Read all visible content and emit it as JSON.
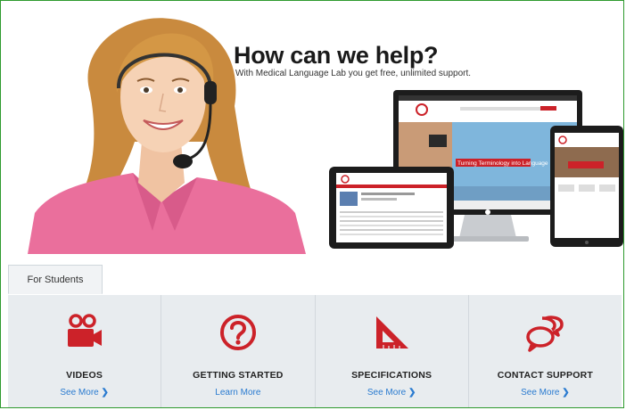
{
  "hero": {
    "title": "How can we help?",
    "subtitle": "With Medical Language Lab you get free, unlimited support.",
    "monitor_banner": "Turning Terminology into Language"
  },
  "tabs": [
    {
      "label": "For Students"
    }
  ],
  "features": [
    {
      "title": "VIDEOS",
      "link": "See More",
      "icon": "video-camera-icon"
    },
    {
      "title": "GETTING STARTED",
      "link": "Learn More",
      "icon": "question-circle-icon"
    },
    {
      "title": "SPECIFICATIONS",
      "link": "See More",
      "icon": "triangle-ruler-icon"
    },
    {
      "title": "CONTACT SUPPORT",
      "link": "See More",
      "icon": "chat-bubbles-icon"
    }
  ],
  "colors": {
    "accent_red": "#cc2229",
    "link_blue": "#2a7bd0",
    "frame_green": "#2e9a2e"
  }
}
